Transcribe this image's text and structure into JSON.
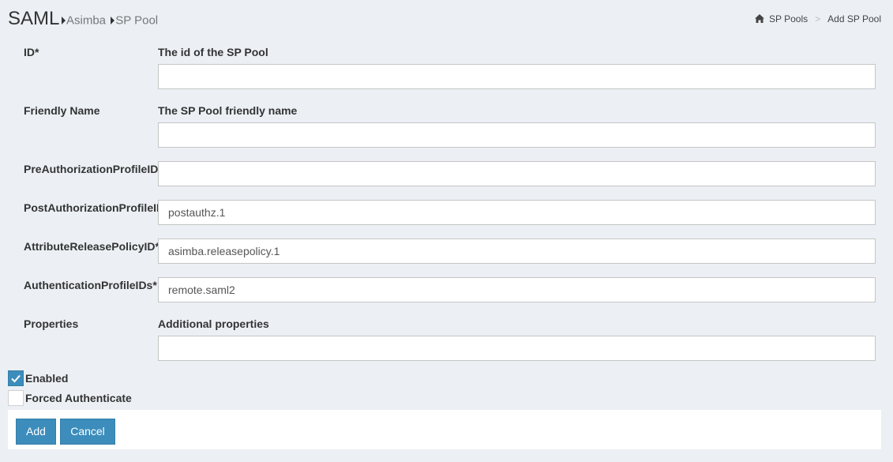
{
  "header": {
    "title": "SAML",
    "sub_crumbs": [
      "Asimba",
      "SP Pool"
    ],
    "breadcrumb": {
      "home_icon": "home-icon",
      "items": [
        "SP Pools",
        "Add SP Pool"
      ],
      "separator": ">"
    }
  },
  "form": {
    "fields": [
      {
        "label": "ID*",
        "description": "The id of the SP Pool",
        "value": ""
      },
      {
        "label": "Friendly Name",
        "description": "The SP Pool friendly name",
        "value": ""
      },
      {
        "label": "PreAuthorizationProfileID",
        "description": "",
        "value": ""
      },
      {
        "label": "PostAuthorizationProfileID",
        "description": "",
        "value": "postauthz.1"
      },
      {
        "label": "AttributeReleasePolicyID*",
        "description": "",
        "value": "asimba.releasepolicy.1"
      },
      {
        "label": "AuthenticationProfileIDs*",
        "description": "",
        "value": "remote.saml2"
      },
      {
        "label": "Properties",
        "description": "Additional properties",
        "value": ""
      }
    ],
    "checkboxes": [
      {
        "label": "Enabled",
        "checked": true
      },
      {
        "label": "Forced Authenticate",
        "checked": false
      }
    ]
  },
  "actions": {
    "add_label": "Add",
    "cancel_label": "Cancel"
  },
  "colors": {
    "background": "#ecf0f5",
    "primary": "#3c8dbc"
  }
}
